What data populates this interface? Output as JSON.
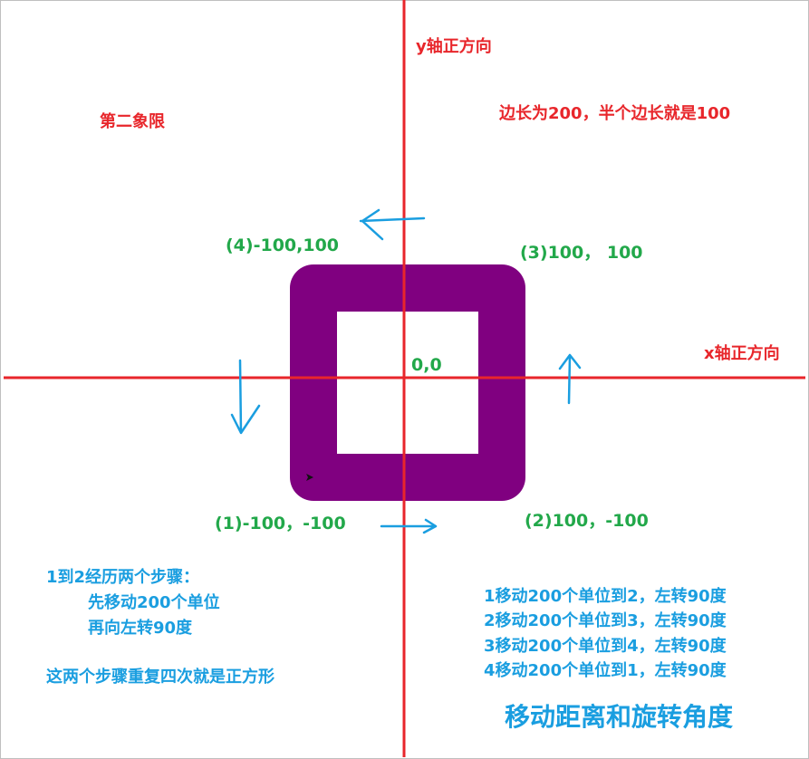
{
  "diagram": {
    "colors": {
      "axis": "#e8262b",
      "square": "#800080",
      "arrow": "#1a9ee0",
      "coord": "#22a84a",
      "note": "#1a9ee0"
    },
    "axis_labels": {
      "y": "y轴正方向",
      "x": "x轴正方向"
    },
    "quadrant_label": "第二象限",
    "side_note": "边长为200，半个边长就是100",
    "origin": "0,0",
    "corners": {
      "p1": "(1)-100，-100",
      "p2": "(2)100，-100",
      "p3": "(3)100， 100",
      "p4": "(4)-100,100"
    },
    "left_note": {
      "line1": "1到2经历两个步骤：",
      "line2": "先移动200个单位",
      "line3": "再向左转90度",
      "line4": "这两个步骤重复四次就是正方形"
    },
    "right_note": {
      "line1": "1移动200个单位到2，左转90度",
      "line2": "2移动200个单位到3，左转90度",
      "line3": "3移动200个单位到4，左转90度",
      "line4": "4移动200个单位到1，左转90度"
    },
    "footer": "移动距离和旋转角度"
  }
}
